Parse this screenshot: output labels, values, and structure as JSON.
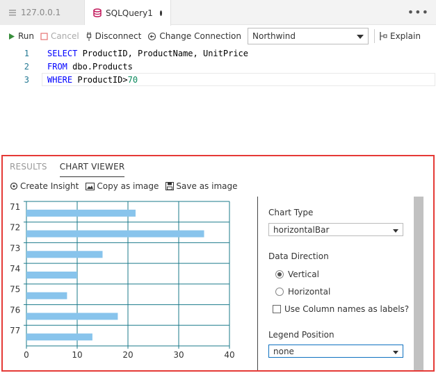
{
  "tabs": [
    {
      "label": "127.0.0.1",
      "icon": "server-icon",
      "active": false
    },
    {
      "label": "SQLQuery1",
      "icon": "database-icon",
      "active": true,
      "dirty": true
    }
  ],
  "toolbar": {
    "run": "Run",
    "cancel": "Cancel",
    "disconnect": "Disconnect",
    "change_connection": "Change Connection",
    "database": "Northwind",
    "explain": "Explain"
  },
  "editor": {
    "lines": [
      {
        "n": "1",
        "kw1": "SELECT",
        "rest": " ProductID, ProductName, UnitPrice"
      },
      {
        "n": "2",
        "kw1": "FROM",
        "rest": " dbo.Products"
      },
      {
        "n": "3",
        "kw1": "WHERE",
        "rest": " ProductID>",
        "num": "70"
      }
    ]
  },
  "results": {
    "tabs": [
      "RESULTS",
      "CHART VIEWER"
    ],
    "active_tab": "CHART VIEWER",
    "actions": {
      "create_insight": "Create Insight",
      "copy_image": "Copy as image",
      "save_image": "Save as image"
    }
  },
  "chart_data": {
    "type": "bar",
    "orientation": "horizontal",
    "categories": [
      "71",
      "72",
      "73",
      "74",
      "75",
      "76",
      "77"
    ],
    "values": [
      21.5,
      35,
      15,
      10,
      8,
      18,
      13
    ],
    "xlim": [
      0,
      40
    ],
    "xticks": [
      "0",
      "10",
      "20",
      "30",
      "40"
    ],
    "grid": true,
    "bar_color": "#88c4ec",
    "axis_color": "#1a7a8a"
  },
  "options": {
    "chart_type_label": "Chart Type",
    "chart_type": "horizontalBar",
    "data_direction_label": "Data Direction",
    "vertical": "Vertical",
    "horizontal": "Horizontal",
    "direction_selected": "Vertical",
    "use_column_names": "Use Column names as labels?",
    "legend_position_label": "Legend Position",
    "legend_position": "none"
  },
  "colors": {
    "highlight_border": "#e53935",
    "keyword": "#0000ff",
    "number": "#09885a",
    "line_number": "#237893"
  }
}
